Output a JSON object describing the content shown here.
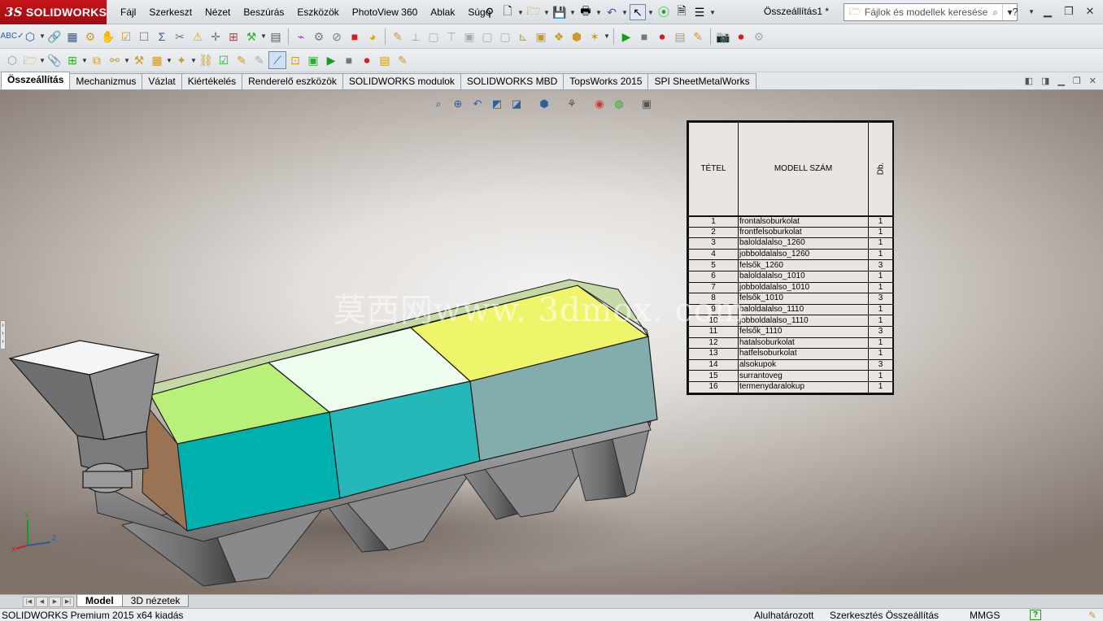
{
  "app": {
    "logo_text": "SOLIDWORKS",
    "doc_title": "Összeállítás1 *"
  },
  "menus": [
    "Fájl",
    "Szerkeszt",
    "Nézet",
    "Beszúrás",
    "Eszközök",
    "PhotoView 360",
    "Ablak",
    "Súgó"
  ],
  "search": {
    "placeholder": "Fájlok és modellek keresése"
  },
  "tabs": [
    {
      "label": "Összeállítás",
      "active": true
    },
    {
      "label": "Mechanizmus",
      "active": false
    },
    {
      "label": "Vázlat",
      "active": false
    },
    {
      "label": "Kiértékelés",
      "active": false
    },
    {
      "label": "Renderelő eszközök",
      "active": false
    },
    {
      "label": "SOLIDWORKS modulok",
      "active": false
    },
    {
      "label": "SOLIDWORKS MBD",
      "active": false
    },
    {
      "label": "TopsWorks 2015",
      "active": false
    },
    {
      "label": "SPI SheetMetalWorks",
      "active": false
    }
  ],
  "bom": {
    "headers": {
      "item": "TÉTEL",
      "model": "MODELL SZÁM",
      "qty": "Db."
    },
    "rows": [
      {
        "item": "1",
        "model": "frontalsoburkolat",
        "qty": "1"
      },
      {
        "item": "2",
        "model": "frontfelsoburkolat",
        "qty": "1"
      },
      {
        "item": "3",
        "model": "baloldalalso_1260",
        "qty": "1"
      },
      {
        "item": "4",
        "model": "jobboldalalso_1260",
        "qty": "1"
      },
      {
        "item": "5",
        "model": "felsők_1260",
        "qty": "3"
      },
      {
        "item": "6",
        "model": "baloldalalso_1010",
        "qty": "1"
      },
      {
        "item": "7",
        "model": "jobboldalalso_1010",
        "qty": "1"
      },
      {
        "item": "8",
        "model": "felsők_1010",
        "qty": "3"
      },
      {
        "item": "9",
        "model": "baloldalalso_1110",
        "qty": "1"
      },
      {
        "item": "10",
        "model": "jobboldalalso_1110",
        "qty": "1"
      },
      {
        "item": "11",
        "model": "felsők_1110",
        "qty": "3"
      },
      {
        "item": "12",
        "model": "hatalsoburkolat",
        "qty": "1"
      },
      {
        "item": "13",
        "model": "hatfelsoburkolat",
        "qty": "1"
      },
      {
        "item": "14",
        "model": "alsokupok",
        "qty": "3"
      },
      {
        "item": "15",
        "model": "surrantoveg",
        "qty": "1"
      },
      {
        "item": "16",
        "model": "termenydaralokup",
        "qty": "1"
      }
    ]
  },
  "watermark": "莫西网www. 3dmox. com",
  "triad": {
    "x": "X",
    "y": "Y",
    "z": "Z"
  },
  "bottom_tabs": [
    {
      "label": "Model",
      "active": true
    },
    {
      "label": "3D nézetek",
      "active": false
    }
  ],
  "status": {
    "product": "SOLIDWORKS Premium 2015 x64 kiadás",
    "constraint": "Alulhatározott",
    "mode": "Szerkesztés Összeállítás",
    "units": "MMGS",
    "help": "?"
  },
  "colors": {
    "brand_red": "#b3121a",
    "panel_green": "#b8f07a",
    "panel_light": "#eefcef",
    "panel_yellow": "#eef56a",
    "side_teal": "#00b0ad",
    "side_cyan": "#26b7b9",
    "side_gray": "#83adad",
    "sheet_gray": "#8d8d8f"
  }
}
